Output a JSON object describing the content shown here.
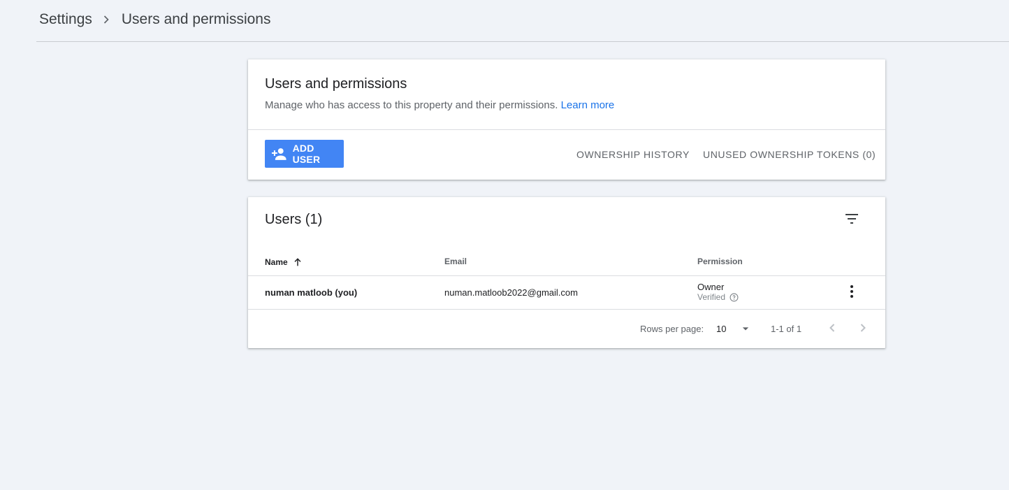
{
  "breadcrumb": {
    "root": "Settings",
    "current": "Users and permissions"
  },
  "header_card": {
    "title": "Users and permissions",
    "description": "Manage who has access to this property and their permissions.",
    "learn_more": "Learn more",
    "add_user_label": "ADD USER",
    "ownership_history_label": "OWNERSHIP HISTORY",
    "unused_tokens_label": "UNUSED OWNERSHIP TOKENS (0)"
  },
  "users_card": {
    "title": "Users (1)",
    "columns": {
      "name": "Name",
      "email": "Email",
      "permission": "Permission"
    },
    "rows": [
      {
        "name": "numan matloob (you)",
        "email": "numan.matloob2022@gmail.com",
        "permission": "Owner",
        "status": "Verified"
      }
    ],
    "footer": {
      "rows_per_page_label": "Rows per page:",
      "rows_per_page_value": "10",
      "range": "1-1 of 1"
    }
  },
  "colors": {
    "accent": "#4285f4",
    "link": "#1a73e8",
    "background": "#f0f3f8"
  },
  "icons": {
    "breadcrumb_separator": "chevron-right-icon",
    "add_user": "person-add-icon",
    "filter": "filter-list-icon",
    "sort": "arrow-upward-icon",
    "help": "help-outline-icon",
    "more": "more-vert-icon",
    "dropdown": "arrow-drop-down-icon",
    "prev": "chevron-left-icon",
    "next": "chevron-right-icon"
  }
}
